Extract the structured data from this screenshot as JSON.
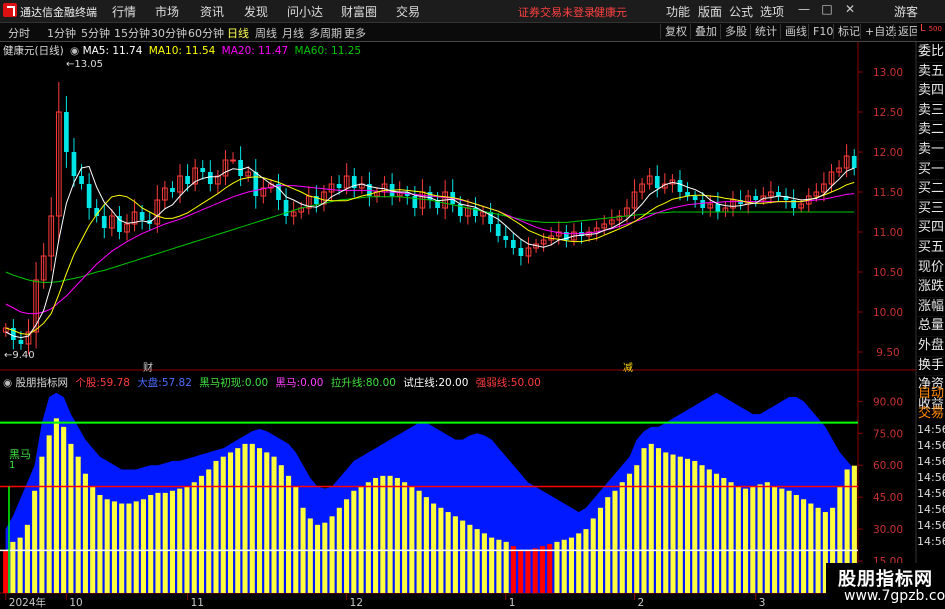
{
  "app": {
    "title": "通达信金融终端",
    "menus": [
      "行情",
      "市场",
      "资讯",
      "发现",
      "问小达",
      "财富圈",
      "交易"
    ],
    "notice": "证券交易未登录",
    "stock_name": "健康元",
    "right_menus": [
      "功能",
      "版面",
      "公式",
      "选项"
    ],
    "user": "游客"
  },
  "toolbar": {
    "periods": [
      "分时",
      "1分钟",
      "5分钟",
      "15分钟",
      "30分钟",
      "60分钟",
      "日线",
      "周线",
      "月线",
      "多周期",
      "更多"
    ],
    "active_period": "日线",
    "right": [
      "复权",
      "叠加",
      "多股",
      "统计",
      "画线",
      "F10",
      "标记",
      "+自选",
      "返回"
    ]
  },
  "side_panel": {
    "corner": "L",
    "corner_num": "500",
    "items": [
      "委比",
      "卖五",
      "卖四",
      "卖三",
      "卖二",
      "卖一",
      "买一",
      "买二",
      "买三",
      "买四",
      "买五",
      "现价",
      "涨跌",
      "涨幅",
      "总量",
      "外盘",
      "换手",
      "净资",
      "收益"
    ],
    "lower": [
      "自动",
      "交易"
    ],
    "times": [
      "14:56",
      "14:56",
      "14:56",
      "14:56",
      "14:56",
      "14:56",
      "14:56",
      "14:56"
    ]
  },
  "legend": {
    "name": "健康元(日线)",
    "ma5": "MA5: 11.74",
    "ma10": "MA10: 11.54",
    "ma20": "MA20: 11.47",
    "ma60": "MA60: 11.25"
  },
  "indicator": {
    "name": "股朋指标网",
    "items": [
      {
        "label": "个股:",
        "value": "59.78"
      },
      {
        "label": "大盘:",
        "value": "57.82"
      },
      {
        "label": "黑马初现:",
        "value": "0.00"
      },
      {
        "label": "黑马:",
        "value": "0.00"
      },
      {
        "label": "拉升线:",
        "value": "80.00"
      },
      {
        "label": "试庄线:",
        "value": "20.00"
      },
      {
        "label": "强弱线:",
        "value": "50.00"
      }
    ],
    "marker_label": "黑马",
    "marker_value": "1"
  },
  "colors": {
    "up": "#ff3c3c",
    "down": "#00e6e6",
    "ma5": "#ffffff",
    "ma10": "#ffff00",
    "ma20": "#ff00ff",
    "ma60": "#00c800",
    "gold": "#ffff40",
    "blue": "#0019ff",
    "red_bar": "#ff0000",
    "green_line": "#00ff00",
    "red_line": "#ff0000",
    "white_line": "#ffffff"
  },
  "annotations": {
    "high": "13.05",
    "low": "9.40",
    "mark1": "财",
    "mark2": "减"
  },
  "watermark": {
    "title": "股朋指标网",
    "url": "www.7gpzb.com"
  },
  "chart_data": [
    {
      "type": "candlestick",
      "title": "健康元(日线)",
      "y_range": [
        9.4,
        13.3
      ],
      "y_ticks": [
        9.5,
        10.0,
        10.5,
        11.0,
        11.5,
        12.0,
        12.5,
        13.0
      ],
      "y_tick_labels": [
        "9.50",
        "10.00",
        "10.50",
        "11.00",
        "11.50",
        "12.00",
        "12.50",
        "13.00"
      ],
      "x_labels": [
        "2024年",
        "10",
        "11",
        "12",
        "1",
        "2",
        "3"
      ],
      "x_label_index": [
        0,
        8,
        24,
        45,
        66,
        83,
        99
      ],
      "close": [
        9.8,
        9.65,
        9.6,
        9.75,
        10.4,
        10.7,
        11.2,
        12.5,
        12.0,
        11.7,
        11.6,
        11.3,
        11.2,
        11.05,
        11.2,
        11.0,
        11.1,
        11.25,
        11.15,
        11.1,
        11.4,
        11.55,
        11.5,
        11.7,
        11.6,
        11.8,
        11.75,
        11.6,
        11.7,
        11.9,
        11.9,
        11.7,
        11.75,
        11.45,
        11.55,
        11.6,
        11.4,
        11.2,
        11.25,
        11.3,
        11.45,
        11.35,
        11.5,
        11.6,
        11.55,
        11.7,
        11.55,
        11.6,
        11.45,
        11.5,
        11.6,
        11.45,
        11.5,
        11.45,
        11.3,
        11.5,
        11.4,
        11.3,
        11.5,
        11.35,
        11.2,
        11.3,
        11.2,
        11.25,
        11.1,
        10.95,
        10.9,
        10.8,
        10.7,
        10.8,
        10.85,
        10.9,
        10.95,
        11.0,
        10.9,
        11.0,
        10.95,
        11.0,
        11.05,
        11.1,
        11.15,
        11.2,
        11.3,
        11.5,
        11.6,
        11.7,
        11.55,
        11.6,
        11.65,
        11.5,
        11.45,
        11.4,
        11.3,
        11.35,
        11.25,
        11.3,
        11.4,
        11.35,
        11.45,
        11.4,
        11.45,
        11.5,
        11.45,
        11.4,
        11.3,
        11.35,
        11.45,
        11.5,
        11.6,
        11.75,
        11.8,
        11.95,
        11.8
      ],
      "ma5": [
        9.75,
        9.7,
        9.68,
        9.7,
        9.84,
        10.02,
        10.34,
        10.9,
        11.36,
        11.62,
        11.8,
        11.82,
        11.56,
        11.37,
        11.27,
        11.15,
        11.11,
        11.12,
        11.14,
        11.12,
        11.2,
        11.29,
        11.34,
        11.45,
        11.55,
        11.63,
        11.67,
        11.69,
        11.69,
        11.75,
        11.79,
        11.78,
        11.81,
        11.74,
        11.67,
        11.6,
        11.55,
        11.44,
        11.4,
        11.35,
        11.32,
        11.31,
        11.36,
        11.44,
        11.49,
        11.54,
        11.58,
        11.6,
        11.57,
        11.55,
        11.54,
        11.51,
        11.5,
        11.5,
        11.46,
        11.44,
        11.43,
        11.39,
        11.4,
        11.41,
        11.35,
        11.33,
        11.31,
        11.26,
        11.21,
        11.16,
        11.08,
        10.99,
        10.91,
        10.85,
        10.83,
        10.81,
        10.84,
        10.9,
        10.92,
        10.95,
        10.96,
        10.97,
        10.98,
        11.02,
        11.05,
        11.1,
        11.16,
        11.25,
        11.35,
        11.47,
        11.53,
        11.59,
        11.62,
        11.6,
        11.56,
        11.53,
        11.48,
        11.4,
        11.35,
        11.33,
        11.32,
        11.33,
        11.35,
        11.36,
        11.42,
        11.43,
        11.45,
        11.44,
        11.42,
        11.4,
        11.41,
        11.42,
        11.47,
        11.57,
        11.66,
        11.76,
        11.8
      ],
      "ma10": [
        9.8,
        9.77,
        9.73,
        9.72,
        9.78,
        9.86,
        9.98,
        10.22,
        10.48,
        10.72,
        10.9,
        11.08,
        11.22,
        11.34,
        11.44,
        11.46,
        11.44,
        11.38,
        11.3,
        11.25,
        11.2,
        11.17,
        11.17,
        11.2,
        11.24,
        11.3,
        11.36,
        11.42,
        11.48,
        11.55,
        11.61,
        11.66,
        11.68,
        11.69,
        11.68,
        11.65,
        11.62,
        11.58,
        11.54,
        11.5,
        11.45,
        11.43,
        11.4,
        11.39,
        11.39,
        11.39,
        11.42,
        11.45,
        11.47,
        11.5,
        11.52,
        11.52,
        11.53,
        11.52,
        11.51,
        11.5,
        11.47,
        11.45,
        11.44,
        11.43,
        11.41,
        11.38,
        11.35,
        11.32,
        11.29,
        11.26,
        11.21,
        11.15,
        11.09,
        11.02,
        10.98,
        10.94,
        10.92,
        10.91,
        10.89,
        10.88,
        10.88,
        10.9,
        10.92,
        10.96,
        11.0,
        11.04,
        11.08,
        11.13,
        11.19,
        11.26,
        11.32,
        11.36,
        11.41,
        11.43,
        11.45,
        11.46,
        11.46,
        11.45,
        11.44,
        11.42,
        11.41,
        11.39,
        11.37,
        11.36,
        11.36,
        11.37,
        11.38,
        11.38,
        11.38,
        11.38,
        11.4,
        11.43,
        11.46,
        11.5,
        11.54,
        11.59,
        11.62
      ],
      "ma20": [
        10.1,
        10.05,
        10.0,
        9.98,
        9.98,
        10.0,
        10.04,
        10.12,
        10.2,
        10.3,
        10.4,
        10.5,
        10.6,
        10.68,
        10.76,
        10.82,
        10.88,
        10.93,
        10.98,
        11.02,
        11.06,
        11.1,
        11.13,
        11.16,
        11.2,
        11.24,
        11.28,
        11.32,
        11.36,
        11.4,
        11.44,
        11.47,
        11.5,
        11.52,
        11.54,
        11.56,
        11.58,
        11.58,
        11.58,
        11.57,
        11.56,
        11.55,
        11.54,
        11.53,
        11.52,
        11.52,
        11.52,
        11.52,
        11.52,
        11.51,
        11.5,
        11.5,
        11.49,
        11.48,
        11.47,
        11.46,
        11.45,
        11.44,
        11.43,
        11.42,
        11.4,
        11.38,
        11.35,
        11.32,
        11.29,
        11.26,
        11.22,
        11.18,
        11.14,
        11.1,
        11.06,
        11.03,
        11.01,
        10.99,
        10.98,
        10.98,
        10.98,
        10.99,
        11.0,
        11.02,
        11.04,
        11.07,
        11.1,
        11.13,
        11.16,
        11.2,
        11.24,
        11.27,
        11.3,
        11.32,
        11.34,
        11.35,
        11.36,
        11.37,
        11.37,
        11.38,
        11.38,
        11.38,
        11.38,
        11.38,
        11.38,
        11.38,
        11.38,
        11.38,
        11.38,
        11.38,
        11.39,
        11.4,
        11.41,
        11.43,
        11.45,
        11.47,
        11.48
      ],
      "ma60": [
        10.5,
        10.46,
        10.43,
        10.4,
        10.38,
        10.37,
        10.37,
        10.38,
        10.4,
        10.42,
        10.44,
        10.47,
        10.5,
        10.52,
        10.55,
        10.58,
        10.61,
        10.64,
        10.67,
        10.7,
        10.73,
        10.76,
        10.79,
        10.82,
        10.85,
        10.88,
        10.91,
        10.94,
        10.97,
        11.0,
        11.03,
        11.06,
        11.09,
        11.12,
        11.15,
        11.18,
        11.21,
        11.24,
        11.27,
        11.3,
        11.32,
        11.34,
        11.36,
        11.38,
        11.4,
        11.41,
        11.42,
        11.43,
        11.44,
        11.44,
        11.44,
        11.44,
        11.44,
        11.43,
        11.42,
        11.41,
        11.4,
        11.38,
        11.36,
        11.34,
        11.32,
        11.3,
        11.28,
        11.26,
        11.24,
        11.22,
        11.2,
        11.18,
        11.16,
        11.14,
        11.13,
        11.12,
        11.12,
        11.12,
        11.12,
        11.13,
        11.14,
        11.15,
        11.16,
        11.17,
        11.18,
        11.19,
        11.2,
        11.21,
        11.22,
        11.23,
        11.24,
        11.24,
        11.25,
        11.25,
        11.25,
        11.25,
        11.25,
        11.25,
        11.25,
        11.25,
        11.25,
        11.25,
        11.25,
        11.25,
        11.25,
        11.25,
        11.25,
        11.25,
        11.25,
        11.25,
        11.25,
        11.25,
        11.25,
        11.25,
        11.25,
        11.25,
        11.25
      ]
    },
    {
      "type": "bar",
      "title": "股朋指标网",
      "y_range": [
        0,
        100
      ],
      "y_ticks": [
        15,
        30,
        45,
        60,
        75,
        90
      ],
      "y_tick_labels": [
        "15.00",
        "30.00",
        "45.00",
        "60.00",
        "75.00",
        "90.00"
      ],
      "series": [
        {
          "name": "个股",
          "values": [
            20,
            24,
            26,
            32,
            48,
            64,
            74,
            82,
            78,
            70,
            64,
            56,
            50,
            46,
            44,
            43,
            42,
            42,
            43,
            44,
            46,
            47,
            47,
            48,
            49,
            50,
            52,
            55,
            58,
            62,
            64,
            66,
            68,
            70,
            70,
            68,
            66,
            64,
            60,
            55,
            50,
            40,
            35,
            32,
            33,
            36,
            40,
            44,
            48,
            50,
            52,
            54,
            55,
            55,
            54,
            52,
            50,
            48,
            45,
            42,
            40,
            38,
            36,
            34,
            32,
            30,
            28,
            26,
            25,
            24,
            22,
            20,
            20,
            21,
            22,
            23,
            24,
            25,
            26,
            28,
            30,
            35,
            40,
            45,
            48,
            52,
            56,
            60,
            68,
            70,
            68,
            66,
            65,
            64,
            63,
            62,
            60,
            58,
            56,
            54,
            52,
            50,
            49,
            50,
            51,
            52,
            50,
            49,
            48,
            46,
            44,
            42,
            40,
            38,
            40,
            50,
            58,
            59.78
          ]
        },
        {
          "name": "大盘",
          "values": [
            30,
            36,
            44,
            52,
            60,
            80,
            92,
            94,
            92,
            84,
            78,
            72,
            68,
            64,
            62,
            60,
            58,
            58,
            58,
            59,
            60,
            60,
            61,
            62,
            62,
            63,
            64,
            65,
            66,
            67,
            68,
            70,
            72,
            74,
            76,
            77,
            76,
            74,
            72,
            70,
            66,
            60,
            54,
            50,
            49,
            50,
            54,
            58,
            62,
            64,
            66,
            68,
            70,
            72,
            74,
            76,
            78,
            80,
            80,
            78,
            76,
            74,
            72,
            72,
            74,
            75,
            74,
            72,
            68,
            64,
            60,
            56,
            52,
            50,
            48,
            46,
            44,
            42,
            40,
            38,
            40,
            44,
            48,
            52,
            56,
            60,
            64,
            72,
            76,
            78,
            78,
            80,
            82,
            84,
            86,
            88,
            90,
            92,
            94,
            92,
            90,
            88,
            86,
            84,
            84,
            86,
            88,
            90,
            92,
            92,
            90,
            86,
            82,
            78,
            72,
            66,
            62,
            57.82
          ]
        }
      ],
      "lines": [
        {
          "name": "拉升线",
          "value": 80
        },
        {
          "name": "强弱线",
          "value": 50
        },
        {
          "name": "试庄线",
          "value": 20
        }
      ]
    }
  ]
}
